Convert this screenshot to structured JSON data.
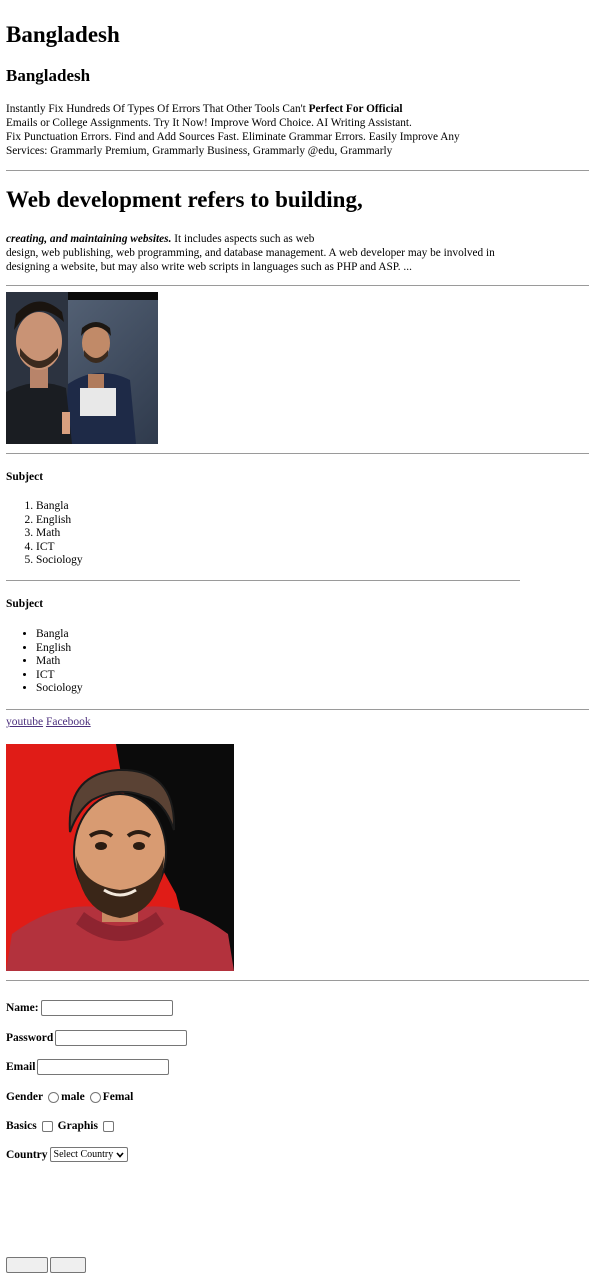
{
  "heading_main": "Bangladesh",
  "heading_sub": "Bangladesh",
  "promo": {
    "line1_start": "Instantly Fix Hundreds Of Types Of Errors That Other Tools Can't ",
    "line1_bold": "Perfect For Official",
    "line2": "Emails or College Assignments. Try It Now! Improve Word Choice. AI Writing Assistant.",
    "line3": "Fix Punctuation Errors. Find and Add Sources Fast. Eliminate Grammar Errors. Easily Improve Any",
    "line4": "Services: Grammarly Premium, Grammarly Business, Grammarly @edu, Grammarly"
  },
  "webdev": {
    "heading": "Web development refers to building,",
    "em": "creating, and maintaining websites.",
    "line1_rest": " It includes aspects such as web",
    "line2": "design, web publishing, web programming, and database management. A web developer may be involved in",
    "line3": "designing a website, but may also write web scripts in languages such as PHP and ASP. ..."
  },
  "ordered": {
    "title": "Subject",
    "items": [
      "Bangla",
      "English",
      "Math",
      "ICT",
      "Sociology"
    ]
  },
  "unordered": {
    "title": "Subject",
    "items": [
      "Bangla",
      "English",
      "Math",
      "ICT",
      "Sociology"
    ]
  },
  "links": {
    "youtube": "youtube",
    "facebook": "Facebook"
  },
  "form": {
    "name_label": "Name:",
    "password_label": "Password",
    "email_label": "Email",
    "gender_label": "Gender",
    "male_label": "male",
    "female_label": "Femal",
    "basics_label": "Basics",
    "graphics_label": "Graphis",
    "country_label": "Country",
    "country_selected": "Select Country"
  },
  "icons": {
    "dropdown": "chevron-down-icon"
  },
  "colors": {
    "link": "#4b2f7d",
    "rule": "#9a9a9a",
    "photo_red": "#e01c17"
  }
}
